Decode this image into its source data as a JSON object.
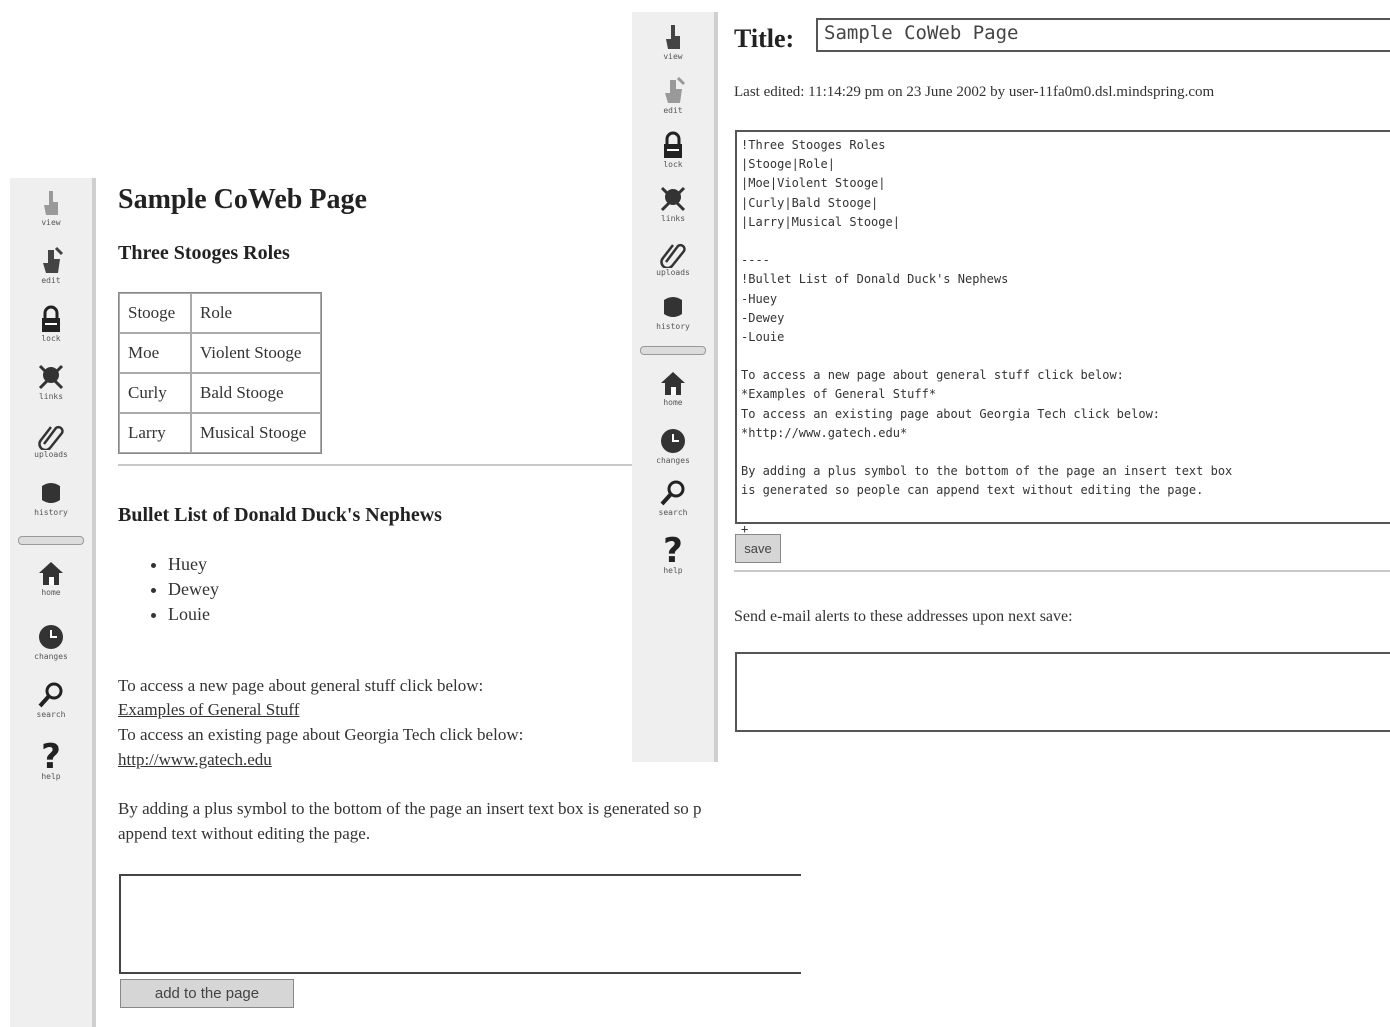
{
  "sidebar": {
    "items": [
      {
        "label": "view",
        "icon": "hand-pointer-icon"
      },
      {
        "label": "edit",
        "icon": "hand-pen-icon"
      },
      {
        "label": "lock",
        "icon": "padlock-icon"
      },
      {
        "label": "links",
        "icon": "chain-links-icon"
      },
      {
        "label": "uploads",
        "icon": "paperclip-icon"
      },
      {
        "label": "history",
        "icon": "scroll-icon"
      },
      {
        "label": "home",
        "icon": "house-icon"
      },
      {
        "label": "changes",
        "icon": "clock-icon"
      },
      {
        "label": "search",
        "icon": "magnifier-icon"
      },
      {
        "label": "help",
        "icon": "question-mark-icon"
      }
    ]
  },
  "view": {
    "page_title": "Sample CoWeb Page",
    "table_heading": "Three Stooges Roles",
    "table": {
      "header": [
        "Stooge",
        "Role"
      ],
      "rows": [
        [
          "Moe",
          "Violent Stooge"
        ],
        [
          "Curly",
          "Bald Stooge"
        ],
        [
          "Larry",
          "Musical Stooge"
        ]
      ]
    },
    "list_heading": "Bullet List of Donald Duck's Nephews",
    "nephews": [
      "Huey",
      "Dewey",
      "Louie"
    ],
    "general_text": "To access a new page about general stuff click below:",
    "general_link": "Examples of General Stuff",
    "gatech_text": "To access an existing page about Georgia Tech click below:",
    "gatech_link": "http://www.gatech.edu",
    "plus_text_1": "By adding a plus symbol to the bottom of the page an insert text box is generated so p",
    "plus_text_2": "append text without editing the page.",
    "add_button": "add to the page"
  },
  "edit": {
    "title_label": "Title:",
    "title_value": "Sample CoWeb Page",
    "last_edited": "Last edited: 11:14:29 pm on 23 June 2002 by user-11fa0m0.dsl.mindspring.com",
    "source_lines": [
      "!Three Stooges Roles",
      "|Stooge|Role|",
      "|Moe|Violent Stooge|",
      "|Curly|Bald Stooge|",
      "|Larry|Musical Stooge|",
      "",
      "----",
      "!Bullet List of Donald Duck's Nephews",
      "-Huey",
      "-Dewey",
      "-Louie",
      "",
      "To access a new page about general stuff click below:",
      "*Examples of General Stuff*",
      "To access an existing page about Georgia Tech click below:",
      "*http://www.gatech.edu*",
      "",
      "By adding a plus symbol to the bottom of the page an insert text box",
      "is generated so people can append text without editing the page.",
      "",
      "+"
    ],
    "save_button": "save",
    "alerts_label": "Send e-mail alerts to these addresses upon next save:"
  }
}
